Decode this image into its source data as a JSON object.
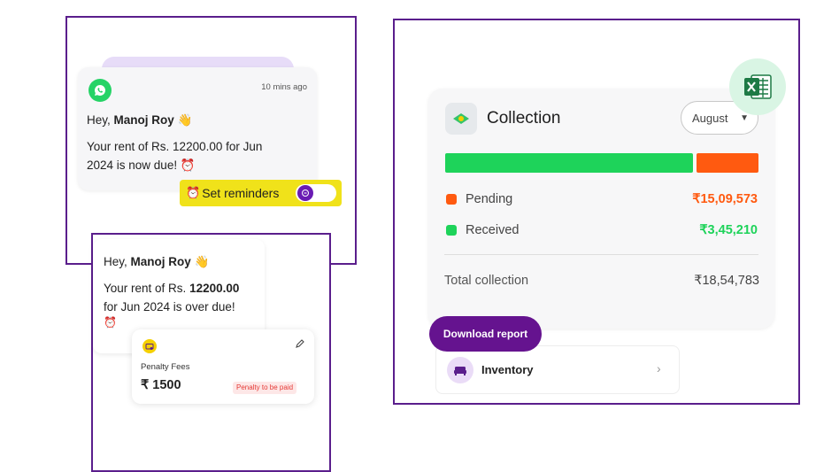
{
  "whatsapp_card": {
    "time": "10 mins ago",
    "greeting_prefix": "Hey,",
    "name": "Manoj Roy",
    "wave": "👋",
    "message_line1": "Your rent of Rs. 12200.00 for Jun",
    "message_line2": "2024 is now due!",
    "alarm": "⏰"
  },
  "reminder": {
    "alarm": "⏰",
    "label": "Set reminders",
    "toggle_on": false
  },
  "overdue_card": {
    "greeting_prefix": "Hey,",
    "name": "Manoj Roy",
    "wave": "👋",
    "line1_prefix": "Your rent of Rs.",
    "line1_amount": "12200.00",
    "line2": "for Jun 2024 is over due!",
    "alarm": "⏰"
  },
  "penalty": {
    "label": "Penalty Fees",
    "amount": "₹ 1500",
    "badge": "Penalty to be paid"
  },
  "collection": {
    "title": "Collection",
    "month": "August",
    "excel_icon": "excel-icon",
    "bar": {
      "received_fraction": 0.8,
      "pending_fraction": 0.2
    },
    "pending_label": "Pending",
    "pending_value": "₹15,09,573",
    "received_label": "Received",
    "received_value": "₹3,45,210",
    "total_label": "Total collection",
    "total_value": "₹18,54,783",
    "colors": {
      "pending": "#ff5a10",
      "received": "#1ed35a",
      "brand": "#65138f"
    }
  },
  "download_button": {
    "label": "Download report"
  },
  "inventory": {
    "label": "Inventory",
    "chevron": "›"
  }
}
